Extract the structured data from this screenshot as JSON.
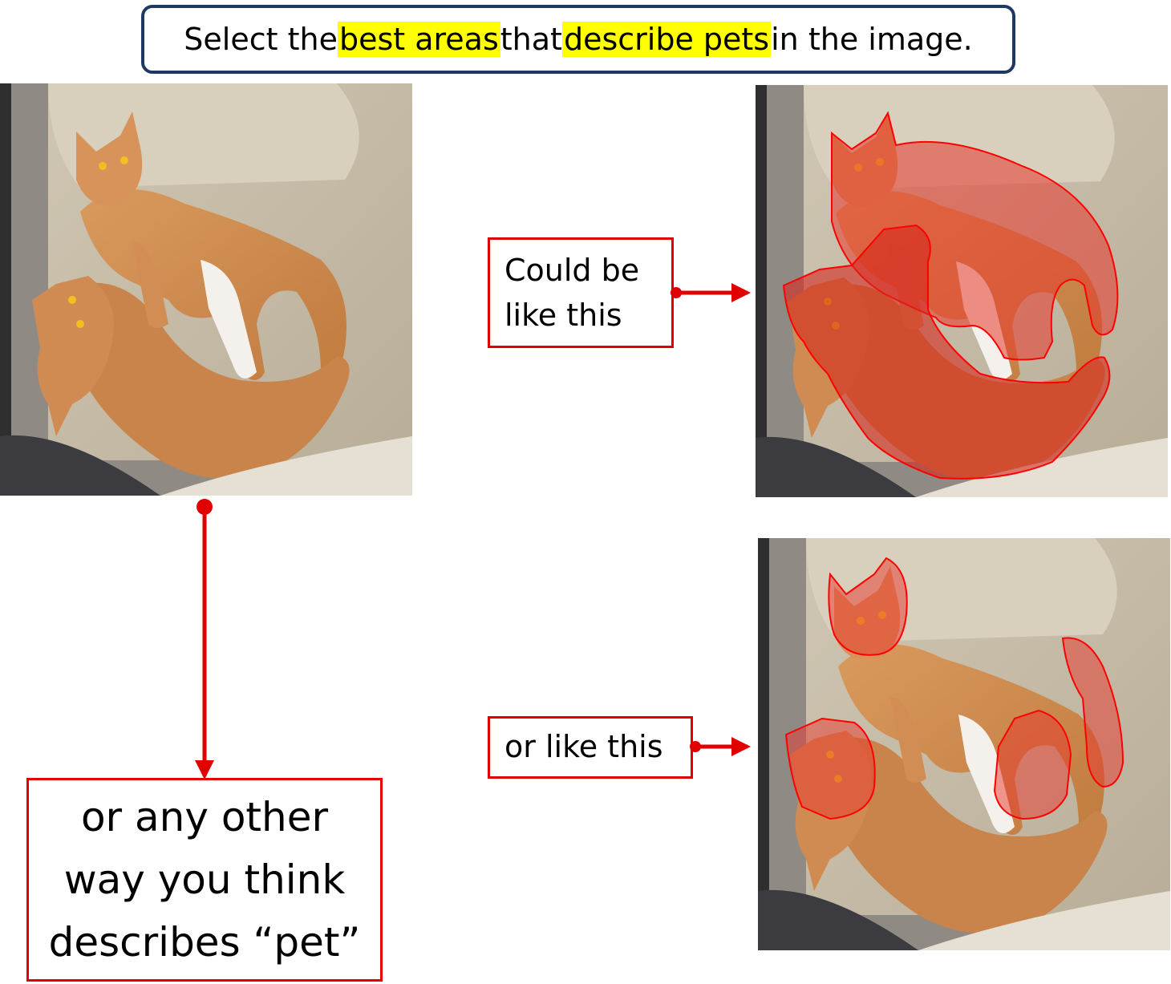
{
  "instruction": {
    "prefix": "Select the ",
    "highlight1": "best areas",
    "middle": " that ",
    "highlight2": "describe pets",
    "suffix": " in the image."
  },
  "labels": {
    "could_be_line1": "Could be",
    "could_be_line2": "like this",
    "or_like_this": "or like this",
    "any_other_line1": "or any other",
    "any_other_line2": "way you think",
    "any_other_line3": "describes “pet”"
  },
  "colors": {
    "frame": "#1f3864",
    "highlight": "#ffff00",
    "annotation": "#e00000",
    "mask_fill": "#e8382e"
  },
  "images": {
    "original": "photo of two orange tabby cats lying on a beige armchair",
    "example_full_masks": "same photo with both whole cat bodies highlighted in red",
    "example_part_masks": "same photo with cat heads, legs and tail highlighted in red"
  }
}
